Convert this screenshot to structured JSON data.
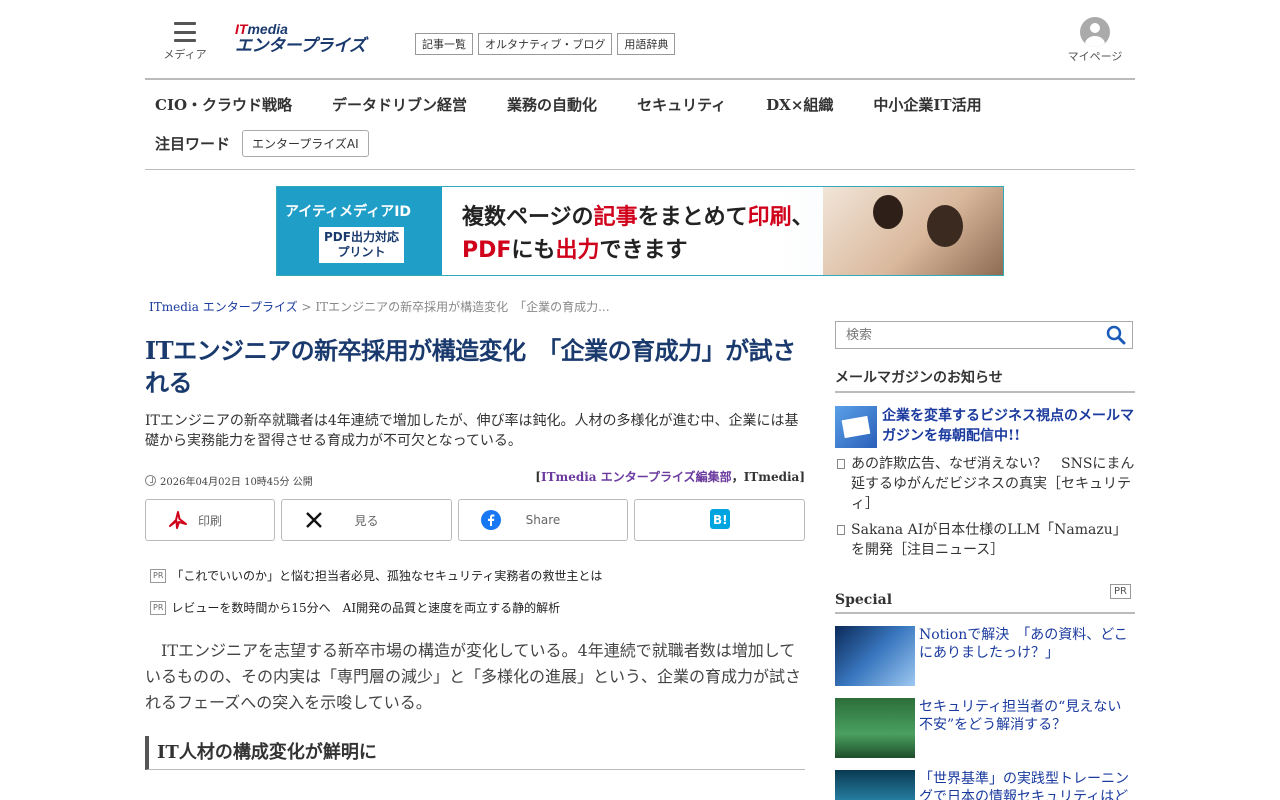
{
  "header": {
    "menu_label": "メディア",
    "logo_it": "IT",
    "logo_media": "media",
    "logo_brand": "エンタープライズ",
    "links": [
      "記事一覧",
      "オルタナティブ・ブログ",
      "用語辞典"
    ],
    "mypage_label": "マイページ"
  },
  "nav": {
    "items": [
      "CIO・クラウド戦略",
      "データドリブン経営",
      "業務の自動化",
      "セキュリティ",
      "DX×組織",
      "中小企業IT活用"
    ],
    "featured_label": "注目ワード",
    "featured_chip": "エンタープライズAI"
  },
  "banner": {
    "left_title": "アイティメディアID",
    "left_badge_1": "PDF出力対応",
    "left_badge_2": "プリント",
    "line1_a": "複数ページの",
    "line1_b": "記事",
    "line1_c": "をまとめて",
    "line1_d": "印刷",
    "line1_e": "、",
    "line2_a": "PDF",
    "line2_b": "にも",
    "line2_c": "出力",
    "line2_d": "できます"
  },
  "breadcrumb": {
    "home": "ITmedia エンタープライズ",
    "sep": " > ",
    "current": "ITエンジニアの新卒採用が構造変化　「企業の育成力..."
  },
  "article": {
    "title": "ITエンジニアの新卒採用が構造変化　「企業の育成力」が試される",
    "lead": "ITエンジニアの新卒就職者は4年連続で増加したが、伸び率は鈍化。人材の多様化が進む中、企業には基礎から実務能力を習得させる育成力が不可欠となっている。",
    "date": "2026年04月02日 10時45分 公開",
    "author_open": "[",
    "author_dept": "ITmedia エンタープライズ編集部",
    "author_sep": "，",
    "author_org": "ITmedia",
    "author_close": "]",
    "share": {
      "print": "印刷",
      "x": "見る",
      "facebook": "Share"
    },
    "pr_badge": "PR",
    "pr_items": [
      "「これでいいのか」と悩む担当者必見、孤独なセキュリティ実務者の救世主とは",
      "レビューを数時間から15分へ　AI開発の品質と速度を両立する静的解析"
    ],
    "body": "ITエンジニアを志望する新卒市場の構造が変化している。4年連続で就職者数は増加しているものの、その内実は「専門層の減少」と「多様化の進展」という、企業の育成力が試されるフェーズへの突入を示唆している。",
    "section_heading": "IT人材の構成変化が鮮明に"
  },
  "sidebar": {
    "search_placeholder": "検索",
    "mail_heading": "メールマガジンのお知らせ",
    "mail_promo": "企業を変革するビジネス視点のメールマガジンを毎朝配信中!!",
    "links": [
      "あの詐欺広告、なぜ消えない？　SNSにまん延するゆがんだビジネスの真実［セキュリティ］",
      "Sakana AIが日本仕様のLLM「Namazu」を開発［注目ニュース］"
    ],
    "special_heading": "Special",
    "special_pr": "PR",
    "special_items": [
      "Notionで解決　「あの資料、どこにありましたっけ？」",
      "セキュリティ担当者の“見えない不安”をどう解消する？",
      "「世界基準」の実践型トレーニングで日本の情報セキュリティはどう変わる"
    ]
  }
}
